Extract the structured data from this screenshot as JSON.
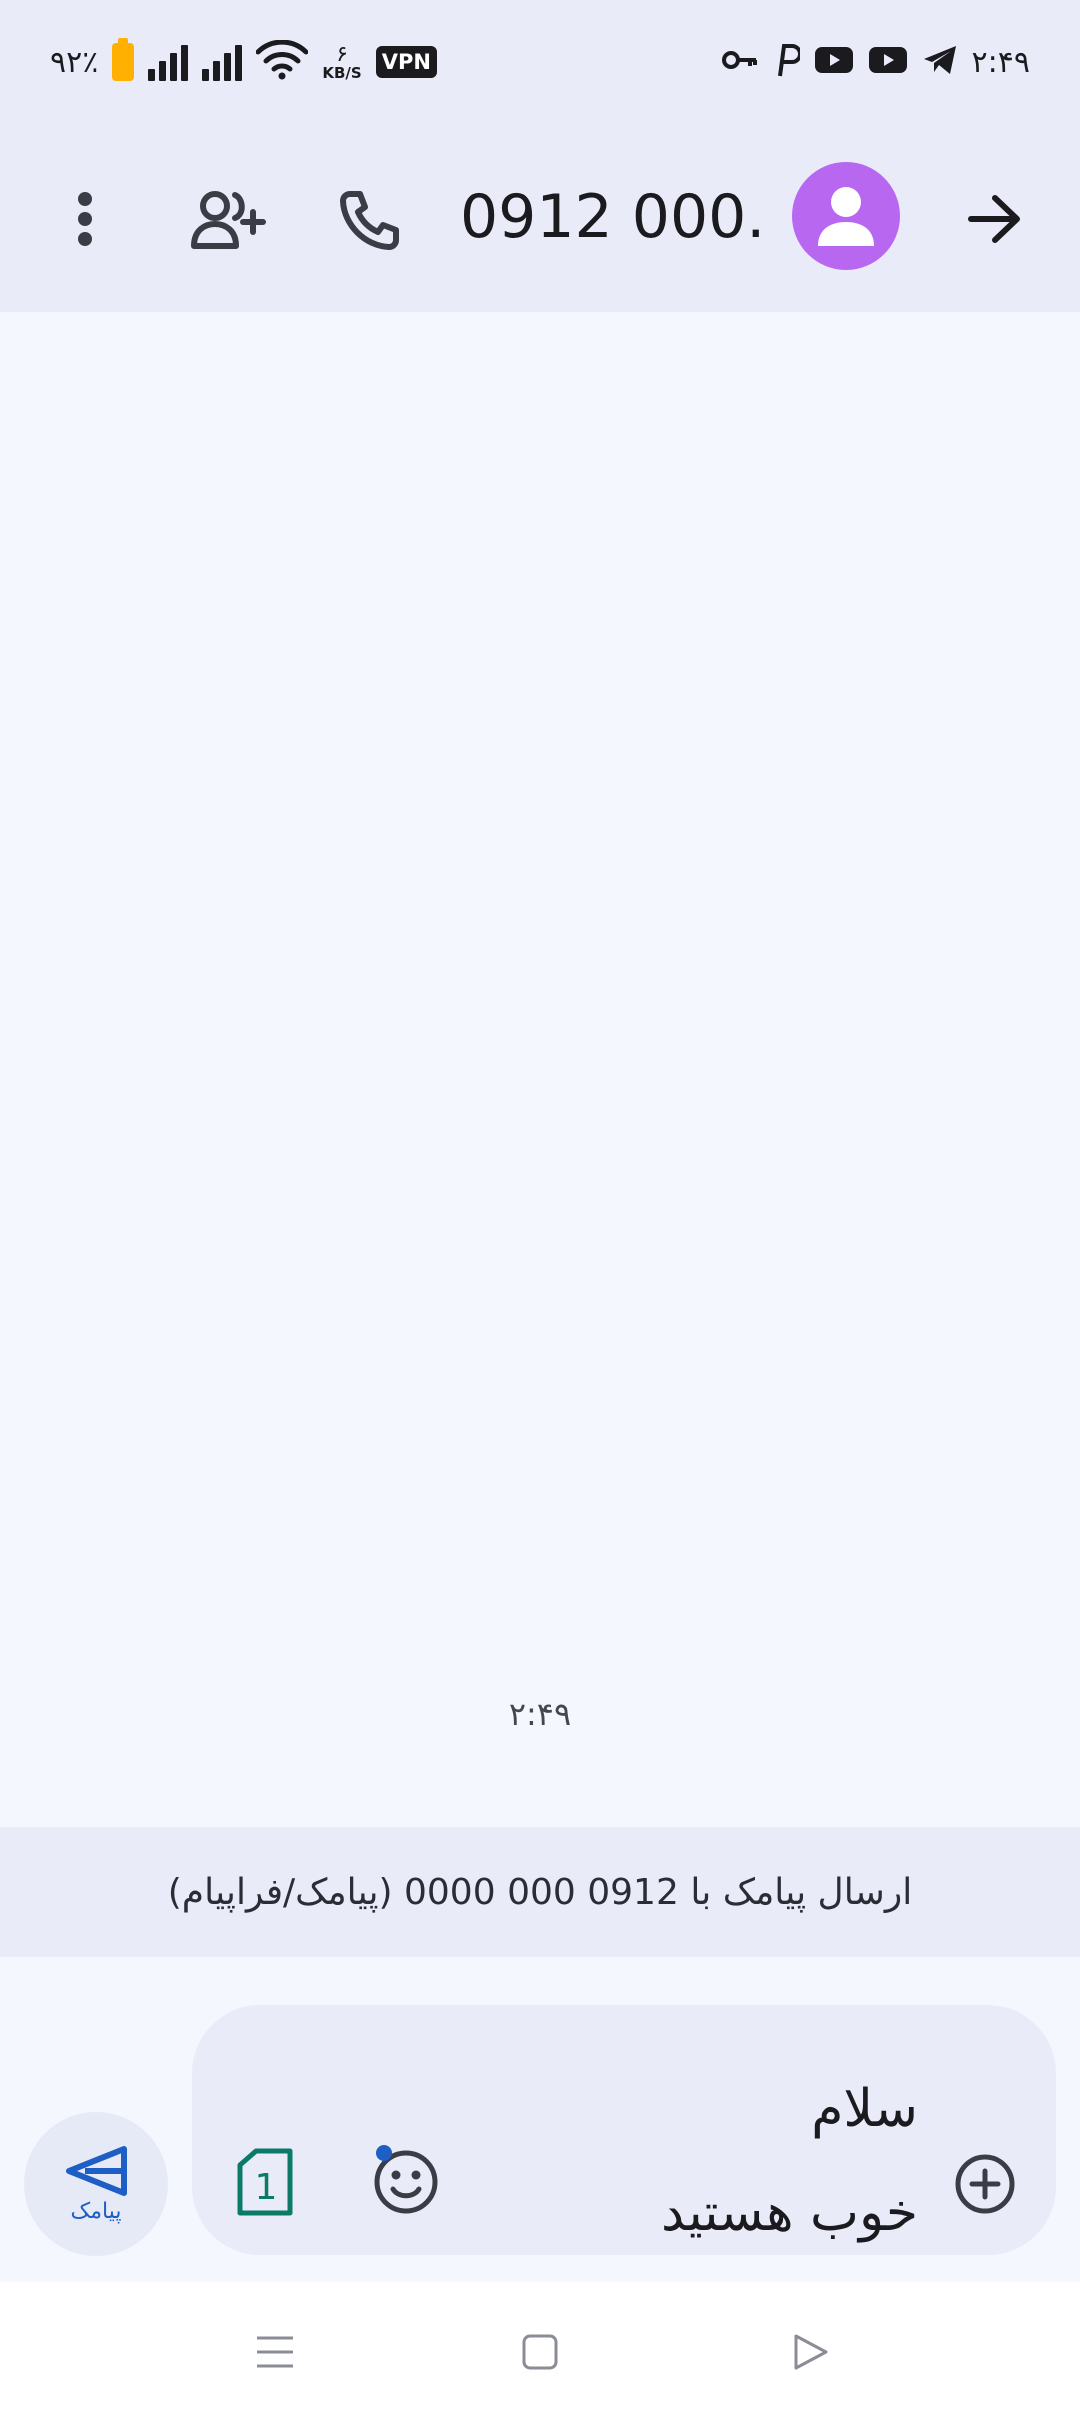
{
  "status_bar": {
    "battery": "۹۲٪",
    "net_speed": "۶",
    "net_unit": "KB/S",
    "vpn": "VPN",
    "time": "۲:۴۹",
    "icons": [
      "battery-icon",
      "signal-icon",
      "signal-icon",
      "wifi-icon",
      "key-icon",
      "p-icon",
      "youtube-icon",
      "youtube-icon",
      "telegram-icon"
    ]
  },
  "app_bar": {
    "title": "0912 000...",
    "icons": [
      "more-vert-icon",
      "add-person-icon",
      "phone-icon",
      "person-avatar-icon",
      "arrow-forward-icon"
    ],
    "avatar_color": "#b868f0"
  },
  "conversation": {
    "timestamp": "۲:۴۹"
  },
  "send_info": "ارسال پیامک با 0912 000 0000 (پیامک/فراپیام)",
  "composer": {
    "line1": "سلام",
    "line2": "خوب هستید",
    "send_label": "پیامک",
    "sim_label": "1",
    "accent": "#1d5fc4",
    "sim_color": "#0b7a68"
  },
  "nav_bar": {
    "icons": [
      "recents-icon",
      "home-icon",
      "back-icon"
    ]
  }
}
